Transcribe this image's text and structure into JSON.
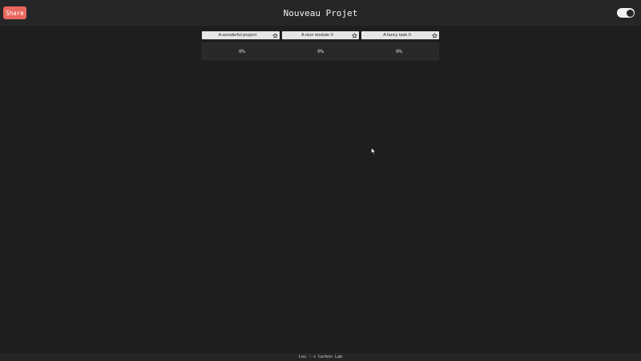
{
  "header": {
    "share_label": "Share",
    "title": "Nouveau Projet",
    "toggle_on": true
  },
  "columns": [
    {
      "label": "A wonderful project",
      "progress": "0%"
    },
    {
      "label": "A nice module 0",
      "progress": "0%"
    },
    {
      "label": "A fancy task 0",
      "progress": "0%"
    }
  ],
  "footer": {
    "credit": "Lou ♡ x Carbon Lab"
  },
  "icons": {
    "favorite": "star-icon",
    "pointer": "mouse-cursor-icon"
  },
  "colors": {
    "share_button": "#e8675e",
    "background": "#1e1e20",
    "header_bg": "#262628"
  }
}
